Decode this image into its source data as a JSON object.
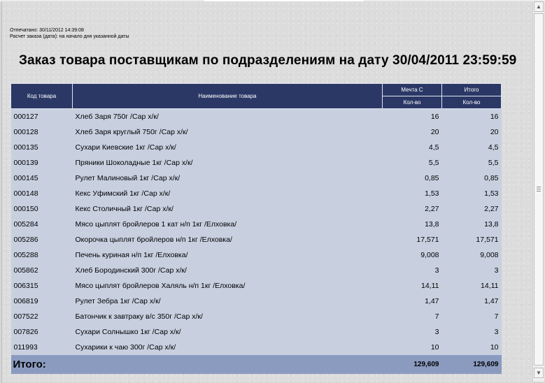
{
  "report": {
    "printed": "Отпечатано: 30/11/2012 14:39:08",
    "calc_mode": "Расчет заказа (дата): на начало дня указанной даты",
    "title": "Заказ товара поставщикам по подразделениям на дату 30/04/2011 23:59:59"
  },
  "table": {
    "headers": {
      "code": "Код товара",
      "name": "Наименование товара",
      "group1": "Мечта С",
      "group2": "Итого",
      "qty1": "Кол-во",
      "qty2": "Кол-во"
    },
    "rows": [
      {
        "code": "000127",
        "name": "Хлеб Заря 750г /Сар х/к/",
        "qty": "16",
        "total": "16"
      },
      {
        "code": "000128",
        "name": "Хлеб Заря круглый 750г /Сар х/к/",
        "qty": "20",
        "total": "20"
      },
      {
        "code": "000135",
        "name": "Сухари Киевские 1кг /Сар х/к/",
        "qty": "4,5",
        "total": "4,5"
      },
      {
        "code": "000139",
        "name": "Пряники Шоколадные 1кг /Сар х/к/",
        "qty": "5,5",
        "total": "5,5"
      },
      {
        "code": "000145",
        "name": "Рулет Малиновый 1кг /Сар х/к/",
        "qty": "0,85",
        "total": "0,85"
      },
      {
        "code": "000148",
        "name": "Кекс Уфимский 1кг /Сар х/к/",
        "qty": "1,53",
        "total": "1,53"
      },
      {
        "code": "000150",
        "name": "Кекс Столичный 1кг /Сар х/к/",
        "qty": "2,27",
        "total": "2,27"
      },
      {
        "code": "005284",
        "name": "Мясо цыплят бройлеров 1 кат н/п 1кг /Елховка/",
        "qty": "13,8",
        "total": "13,8"
      },
      {
        "code": "005286",
        "name": "Окорочка цыплят бройлеров н/п 1кг /Елховка/",
        "qty": "17,571",
        "total": "17,571"
      },
      {
        "code": "005288",
        "name": "Печень куриная н/п 1кг /Елховка/",
        "qty": "9,008",
        "total": "9,008"
      },
      {
        "code": "005862",
        "name": "Хлеб Бородинский 300г /Сар х/к/",
        "qty": "3",
        "total": "3"
      },
      {
        "code": "006315",
        "name": "Мясо цыплят бройлеров Халяль н/п 1кг /Елховка/",
        "qty": "14,11",
        "total": "14,11"
      },
      {
        "code": "006819",
        "name": "Рулет Зебра 1кг /Сар х/к/",
        "qty": "1,47",
        "total": "1,47"
      },
      {
        "code": "007522",
        "name": "Батончик к завтраку в/с 350г /Сар х/к/",
        "qty": "7",
        "total": "7"
      },
      {
        "code": "007826",
        "name": "Сухари Солнышко 1кг /Сар х/к/",
        "qty": "3",
        "total": "3"
      },
      {
        "code": "011993",
        "name": "Сухарики к чаю 300г /Сар х/к/",
        "qty": "10",
        "total": "10"
      }
    ],
    "footer": {
      "label": "Итого:",
      "qty": "129,609",
      "total": "129,609"
    }
  },
  "scrollbar": {
    "up_glyph": "▲",
    "down_glyph": "▼",
    "grip_glyph": "≡"
  },
  "colors": {
    "header_bg": "#2b3866",
    "row_bg": "#c8d0e0",
    "total_bg": "#8b9bc0"
  }
}
